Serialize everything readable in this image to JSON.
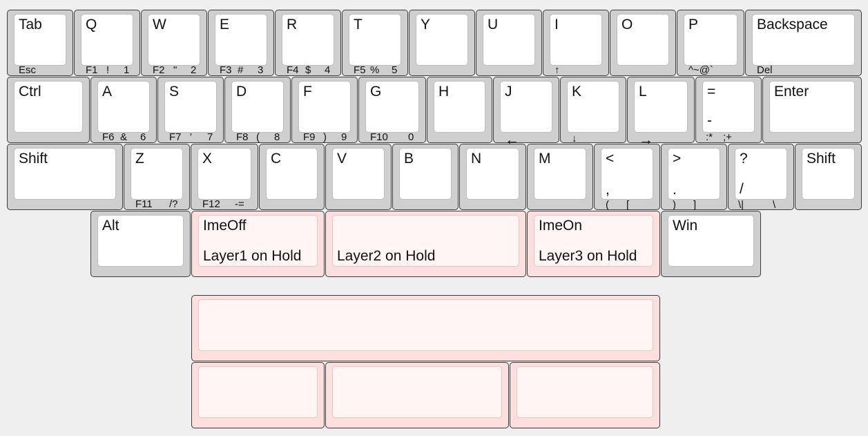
{
  "colors": {
    "background": "#efefef",
    "key": "#cfcfcf",
    "cap": "#ffffff",
    "layer_key": "#fbdede",
    "layer_cap": "#fff5f5"
  },
  "rows": {
    "r1": [
      {
        "main": "Tab",
        "subs": [
          "Esc"
        ]
      },
      {
        "main": "Q",
        "subs": [
          "F1",
          "!",
          "1"
        ]
      },
      {
        "main": "W",
        "subs": [
          "F2",
          "\"",
          "2"
        ]
      },
      {
        "main": "E",
        "subs": [
          "F3",
          "#",
          "3"
        ]
      },
      {
        "main": "R",
        "subs": [
          "F4",
          "$",
          "4"
        ]
      },
      {
        "main": "T",
        "subs": [
          "F5",
          "%",
          "5"
        ]
      },
      {
        "main": "Y",
        "subs": []
      },
      {
        "main": "U",
        "subs": []
      },
      {
        "main": "I",
        "subs": [
          "↑"
        ]
      },
      {
        "main": "O",
        "subs": []
      },
      {
        "main": "P",
        "subs": [
          "^~@`"
        ]
      },
      {
        "main": "Backspace",
        "subs": [
          "Del"
        ]
      }
    ],
    "r2": [
      {
        "main": "Ctrl",
        "subs": []
      },
      {
        "main": "A",
        "subs": [
          "F6",
          "&",
          "6"
        ]
      },
      {
        "main": "S",
        "subs": [
          "F7",
          "'",
          "7"
        ]
      },
      {
        "main": "D",
        "subs": [
          "F8",
          "(",
          "8"
        ]
      },
      {
        "main": "F",
        "subs": [
          "F9",
          ")",
          "9"
        ]
      },
      {
        "main": "G",
        "subs": [
          "F10",
          "0"
        ]
      },
      {
        "main": "H",
        "subs": []
      },
      {
        "main": "J",
        "subs": [
          "←"
        ]
      },
      {
        "main": "K",
        "subs": [
          "↓"
        ]
      },
      {
        "main": "L",
        "subs": [
          "→"
        ]
      },
      {
        "main": "=",
        "mid": "-",
        "subs": [
          ":*",
          ";+"
        ]
      },
      {
        "main": "Enter",
        "subs": []
      }
    ],
    "r3": [
      {
        "main": "Shift",
        "subs": []
      },
      {
        "main": "Z",
        "subs": [
          "F11",
          "/?"
        ]
      },
      {
        "main": "X",
        "subs": [
          "F12",
          "-="
        ]
      },
      {
        "main": "C",
        "subs": []
      },
      {
        "main": "V",
        "subs": []
      },
      {
        "main": "B",
        "subs": []
      },
      {
        "main": "N",
        "subs": []
      },
      {
        "main": "M",
        "subs": []
      },
      {
        "main": "<",
        "mid": ",",
        "subs": [
          "(",
          "["
        ]
      },
      {
        "main": ">",
        "mid": ".",
        "subs": [
          ")",
          "]"
        ]
      },
      {
        "main": "?",
        "mid": "/",
        "subs": [
          "\\|",
          "\\"
        ]
      },
      {
        "main": "Shift",
        "subs": []
      }
    ],
    "r4": [
      {
        "main": "Alt"
      },
      {
        "main": "ImeOff",
        "mid": "Layer1 on Hold"
      },
      {
        "main": "",
        "mid": "Layer2 on Hold"
      },
      {
        "main": "ImeOn",
        "mid": "Layer3 on Hold"
      },
      {
        "main": "Win"
      }
    ]
  }
}
